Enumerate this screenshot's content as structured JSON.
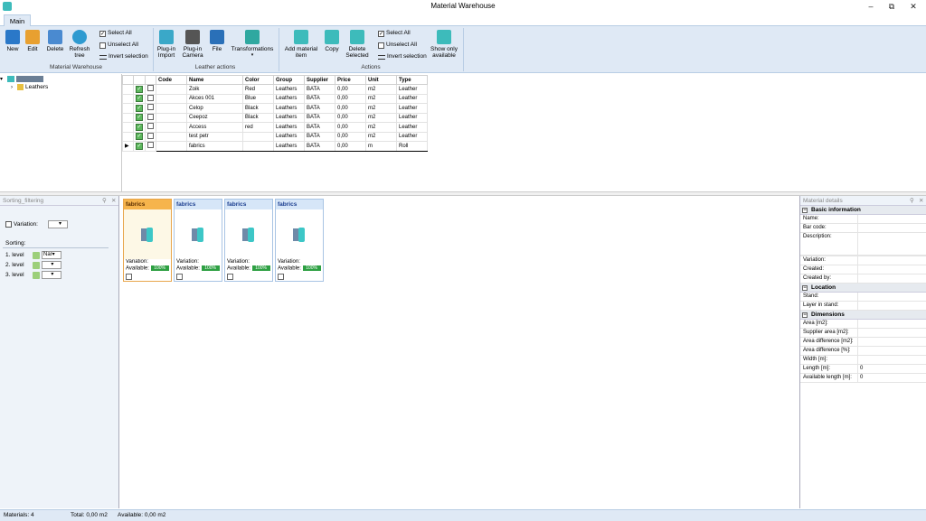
{
  "window": {
    "title": "Material Warehouse"
  },
  "ribbon": {
    "tab": "Main",
    "material_warehouse": {
      "new": "New",
      "edit": "Edit",
      "delete": "Delete",
      "refresh": "Refresh tree",
      "select_all": "Select All",
      "unselect_all": "Unselect All",
      "invert": "Invert selection",
      "group_label": "Material Warehouse"
    },
    "leather_actions": {
      "plugin_import": "Plug-in Import",
      "plugin_camera": "Plug-in Camera",
      "file": "File",
      "transformations": "Transformations",
      "group_label": "Leather actions"
    },
    "actions": {
      "add_item": "Add material item",
      "copy": "Copy",
      "delete_selected": "Delete Selected",
      "select_all": "Select All",
      "unselect_all": "Unselect All",
      "invert": "Invert selection",
      "show_only": "Show only available",
      "group_label": "Actions"
    }
  },
  "tree": {
    "root": "Materials",
    "child": "Leathers"
  },
  "grid": {
    "columns": [
      "Code",
      "Name",
      "Color",
      "Group",
      "Supplier",
      "Price",
      "Unit",
      "Type"
    ],
    "rows": [
      [
        "",
        "Zoik",
        "Red",
        "Leathers",
        "BATA",
        "0,00",
        "m2",
        "Leather"
      ],
      [
        "",
        "Akces 001",
        "Blue",
        "Leathers",
        "BATA",
        "0,00",
        "m2",
        "Leather"
      ],
      [
        "",
        "Celop",
        "Black",
        "Leathers",
        "BATA",
        "0,00",
        "m2",
        "Leather"
      ],
      [
        "",
        "Ceepoz",
        "Black",
        "Leathers",
        "BATA",
        "0,00",
        "m2",
        "Leather"
      ],
      [
        "",
        "Access",
        "red",
        "Leathers",
        "BATA",
        "0,00",
        "m2",
        "Leather"
      ],
      [
        "",
        "test petr",
        "",
        "Leathers",
        "BATA",
        "0,00",
        "m2",
        "Leather"
      ],
      [
        "",
        "fabrics",
        "",
        "Leathers",
        "BATA",
        "0,00",
        "m",
        "Roll"
      ]
    ]
  },
  "filter_panel": {
    "title": "Sorting_filtering",
    "variation_label": "Variation:",
    "sorting_label": "Sorting:",
    "levels": [
      "1. level",
      "2. level",
      "3. level"
    ],
    "level1_value": "Nar"
  },
  "cards": [
    {
      "title": "fabrics",
      "variation": "Variation:",
      "available": "Available:",
      "avail_value": "100%"
    },
    {
      "title": "fabrics",
      "variation": "Variation:",
      "available": "Available:",
      "avail_value": "100%"
    },
    {
      "title": "fabrics",
      "variation": "Variation:",
      "available": "Available:",
      "avail_value": "100%"
    },
    {
      "title": "fabrics",
      "variation": "Variation:",
      "available": "Available:",
      "avail_value": "100%"
    }
  ],
  "details": {
    "title": "Material details",
    "basic": {
      "heading": "Basic information",
      "fields": [
        "Name:",
        "Bar code:",
        "Description:",
        "",
        "Variation:",
        "Created:",
        "Created by:"
      ]
    },
    "location": {
      "heading": "Location",
      "fields": [
        "Stand:",
        "Layer in stand:"
      ]
    },
    "dimensions": {
      "heading": "Dimensions",
      "fields": [
        {
          "label": "Area [m2]:",
          "value": ""
        },
        {
          "label": "Supplier area [m2]:",
          "value": ""
        },
        {
          "label": "Area difference [m2]:",
          "value": ""
        },
        {
          "label": "Area difference [%]:",
          "value": ""
        },
        {
          "label": "Width [m]:",
          "value": ""
        },
        {
          "label": "Length [m]:",
          "value": "0"
        },
        {
          "label": "Available length [m]:",
          "value": "0"
        }
      ]
    }
  },
  "status": {
    "materials": "Materials: 4",
    "total": "Total: 0,00 m2",
    "available": "Available: 0,00 m2"
  },
  "colors": {
    "ribbon_bg": "#dfe9f5",
    "selected_card": "#f6b44c",
    "available_green": "#2ea043"
  }
}
